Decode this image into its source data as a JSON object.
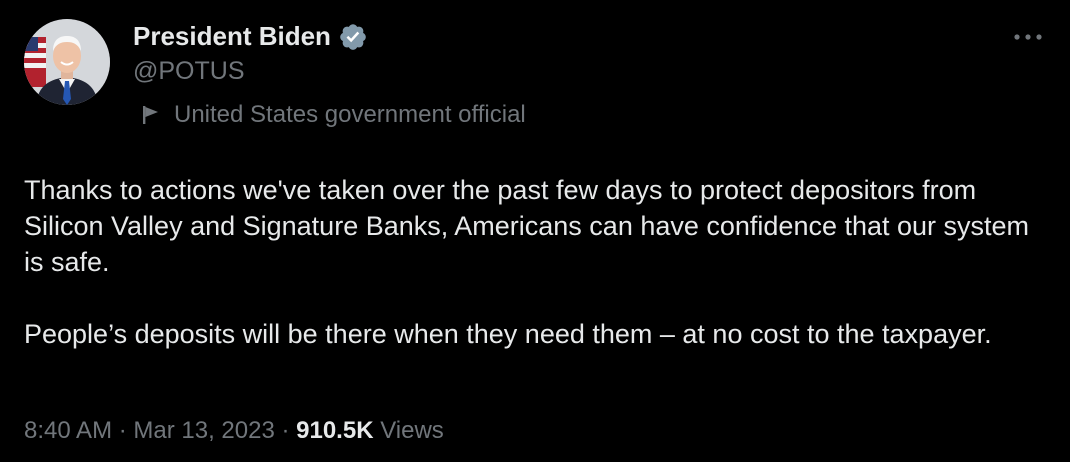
{
  "author": {
    "display_name": "President Biden",
    "handle": "@POTUS",
    "affiliation": "United States government official",
    "verified_color": "#829aab",
    "avatar_icon": "president-portrait-avatar"
  },
  "menu": {
    "more_icon": "ellipsis-icon"
  },
  "tweet": {
    "paragraphs": [
      "Thanks to actions we've taken over the past few days to protect depositors from Silicon Valley and Signature Banks, Americans can have confidence that our system is safe.",
      "People’s deposits will be there when they need them – at no cost to the taxpayer."
    ]
  },
  "meta": {
    "time": "8:40 AM",
    "separator": " · ",
    "date": "Mar 13, 2023",
    "views_count": "910.5K",
    "views_label": " Views"
  },
  "colors": {
    "background": "#000000",
    "primary_text": "#e7e9ea",
    "secondary_text": "#71767b"
  }
}
